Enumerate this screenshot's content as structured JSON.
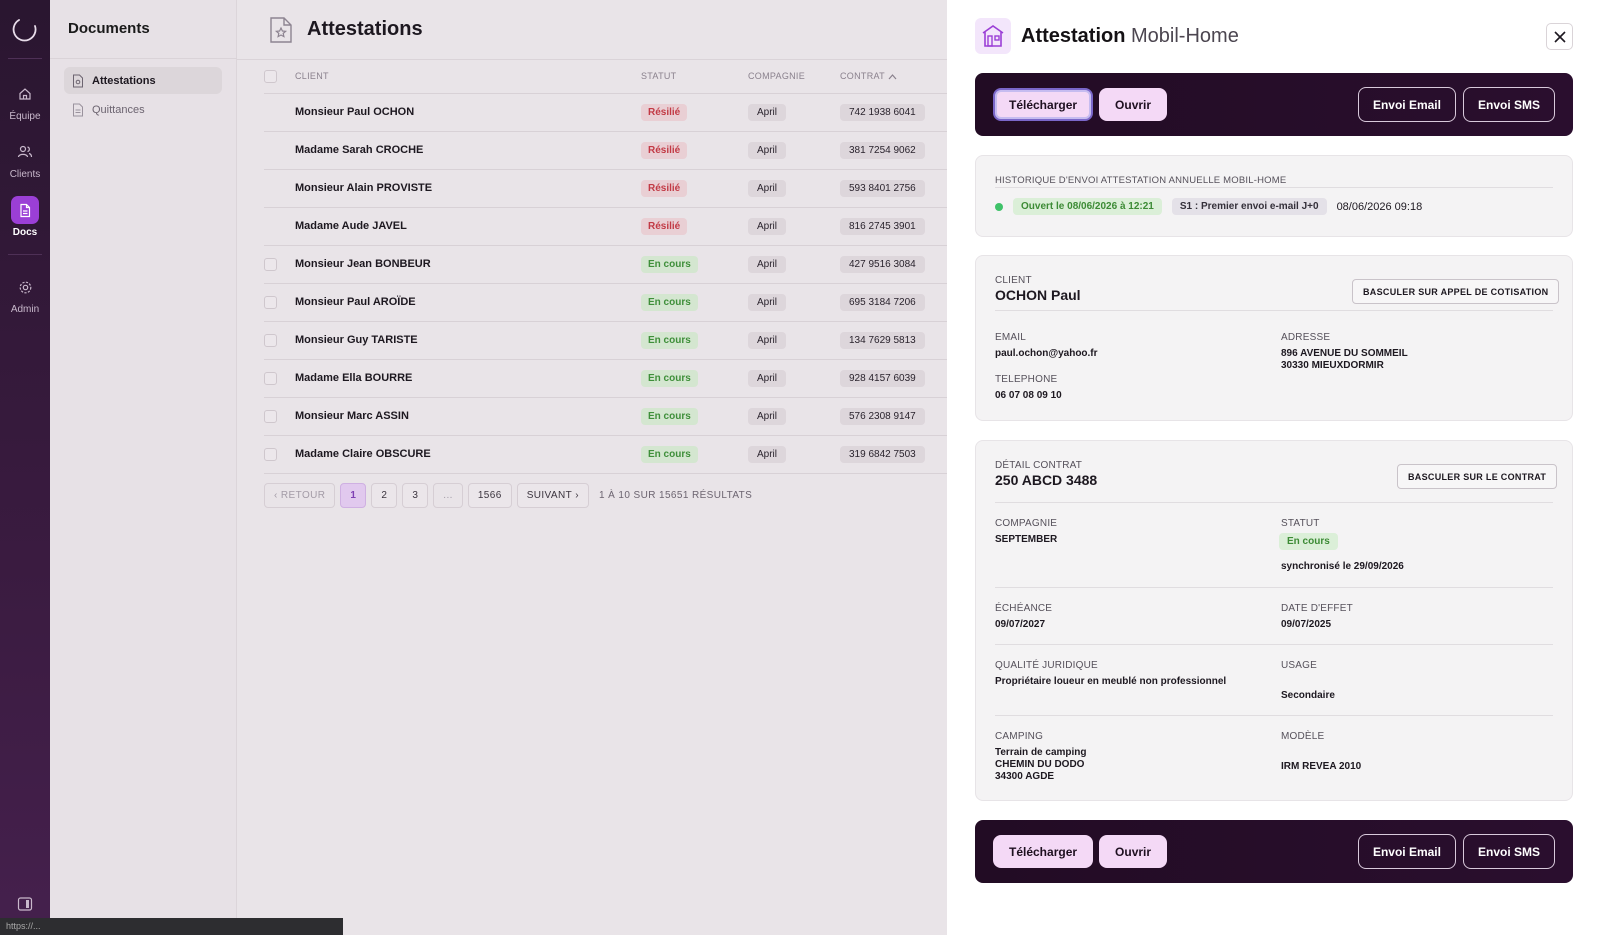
{
  "rail": {
    "items": [
      {
        "label": "Équipe",
        "icon": "home-icon"
      },
      {
        "label": "Clients",
        "icon": "users-icon"
      },
      {
        "label": "Docs",
        "icon": "document-icon",
        "active": true
      },
      {
        "label": "Admin",
        "icon": "gear-icon"
      }
    ]
  },
  "sidebar": {
    "title": "Documents",
    "items": [
      {
        "label": "Attestations",
        "active": true
      },
      {
        "label": "Quittances"
      }
    ]
  },
  "main": {
    "title": "Attestations",
    "columns": {
      "client": "CLIENT",
      "statut": "STATUT",
      "compagnie": "COMPAGNIE",
      "contrat": "CONTRAT"
    },
    "rows": [
      {
        "client": "Monsieur Paul OCHON",
        "statut": "Résilié",
        "status_type": "red",
        "compagnie": "April",
        "contrat": "742 1938 6041"
      },
      {
        "client": "Madame Sarah CROCHE",
        "statut": "Résilié",
        "status_type": "red",
        "compagnie": "April",
        "contrat": "381 7254 9062"
      },
      {
        "client": "Monsieur Alain PROVISTE",
        "statut": "Résilié",
        "status_type": "red",
        "compagnie": "April",
        "contrat": "593 8401 2756"
      },
      {
        "client": "Madame Aude JAVEL",
        "statut": "Résilié",
        "status_type": "red",
        "compagnie": "April",
        "contrat": "816 2745 3901"
      },
      {
        "client": "Monsieur Jean BONBEUR",
        "statut": "En cours",
        "status_type": "green",
        "compagnie": "April",
        "contrat": "427 9516 3084"
      },
      {
        "client": "Monsieur Paul AROÏDE",
        "statut": "En cours",
        "status_type": "green",
        "compagnie": "April",
        "contrat": "695 3184 7206"
      },
      {
        "client": "Monsieur Guy TARISTE",
        "statut": "En cours",
        "status_type": "green",
        "compagnie": "April",
        "contrat": "134 7629 5813"
      },
      {
        "client": "Madame Ella BOURRE",
        "statut": "En cours",
        "status_type": "green",
        "compagnie": "April",
        "contrat": "928 4157 6039"
      },
      {
        "client": "Monsieur Marc ASSIN",
        "statut": "En cours",
        "status_type": "green",
        "compagnie": "April",
        "contrat": "576 2308 9147"
      },
      {
        "client": "Madame Claire OBSCURE",
        "statut": "En cours",
        "status_type": "green",
        "compagnie": "April",
        "contrat": "319 6842 7503"
      }
    ],
    "pagination": {
      "prev": "RETOUR",
      "pages": [
        "1",
        "2",
        "3",
        "...",
        "1566"
      ],
      "next": "SUIVANT",
      "info": "1 À 10 SUR 15651 RÉSULTATS"
    }
  },
  "status_url": "https://...",
  "drawer": {
    "title_bold": "Attestation",
    "title_rest": "Mobil-Home",
    "actions": {
      "download": "Télécharger",
      "open": "Ouvrir",
      "email": "Envoi Email",
      "sms": "Envoi SMS"
    },
    "history": {
      "title": "HISTORIQUE D'ENVOI ATTESTATION ANNUELLE MOBIL-HOME",
      "opened": "Ouvert le 08/06/2026 à 12:21",
      "step": "S1 : Premier envoi e-mail J+0",
      "date": "08/06/2026 09:18"
    },
    "client": {
      "label": "CLIENT",
      "name": "OCHON Paul",
      "switch_button": "BASCULER SUR APPEL DE COTISATION",
      "email_label": "EMAIL",
      "email": "paul.ochon@yahoo.fr",
      "phone_label": "TELEPHONE",
      "phone": "06 07 08 09 10",
      "address_label": "ADRESSE",
      "address_line1": "896 AVENUE DU SOMMEIL",
      "address_line2": "30330 MIEUXDORMIR"
    },
    "contract": {
      "label": "DÉTAIL CONTRAT",
      "number": "250 ABCD 3488",
      "switch_button": "BASCULER SUR LE CONTRAT",
      "company_label": "COMPAGNIE",
      "company": "SEPTEMBER",
      "status_label": "STATUT",
      "status": "En cours",
      "sync": "synchronisé le 29/09/2026",
      "due_label": "ÉCHÉANCE",
      "due": "09/07/2027",
      "effect_label": "DATE D'EFFET",
      "effect": "09/07/2025",
      "legal_label": "QUALITÉ JURIDIQUE",
      "legal": "Propriétaire loueur en meublé non professionnel",
      "usage_label": "USAGE",
      "usage": "Secondaire",
      "camping_label": "CAMPING",
      "camping_line1": "Terrain de camping",
      "camping_line2": "CHEMIN DU DODO",
      "camping_line3": "34300 AGDE",
      "model_label": "MODÈLE",
      "model": "IRM REVEA 2010"
    }
  }
}
